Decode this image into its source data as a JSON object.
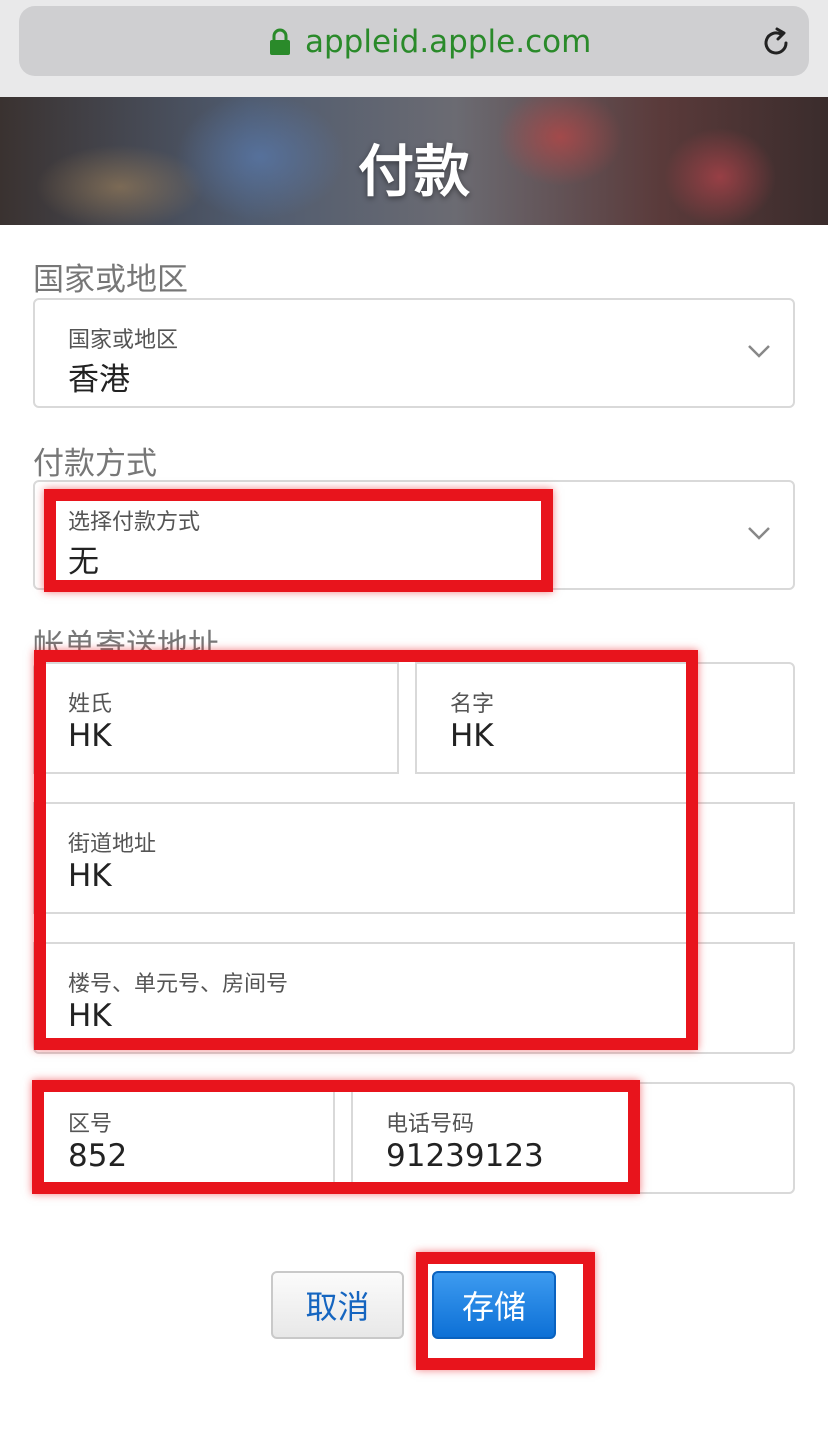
{
  "browser": {
    "url": "appleid.apple.com"
  },
  "header": {
    "title": "付款"
  },
  "country_section": {
    "heading": "国家或地区",
    "field_label": "国家或地区",
    "field_value": "香港"
  },
  "payment_section": {
    "heading": "付款方式",
    "field_label": "选择付款方式",
    "field_value": "无"
  },
  "billing_section": {
    "heading": "帐单寄送地址",
    "last_name": {
      "label": "姓氏",
      "value": "HK"
    },
    "first_name": {
      "label": "名字",
      "value": "HK"
    },
    "street": {
      "label": "街道地址",
      "value": "HK"
    },
    "unit": {
      "label": "楼号、单元号、房间号",
      "value": "HK"
    },
    "area_code": {
      "label": "区号",
      "value": "852"
    },
    "phone": {
      "label": "电话号码",
      "value": "91239123"
    }
  },
  "actions": {
    "cancel_label": "取消",
    "save_label": "存储"
  },
  "colors": {
    "accent": "#1565c0",
    "save_button": "#0d70d6",
    "url_text": "#2a8a2a",
    "highlight": "#e8141c"
  },
  "icons": {
    "lock": "lock-icon",
    "reload": "reload-icon",
    "chevron": "chevron-down-icon"
  }
}
